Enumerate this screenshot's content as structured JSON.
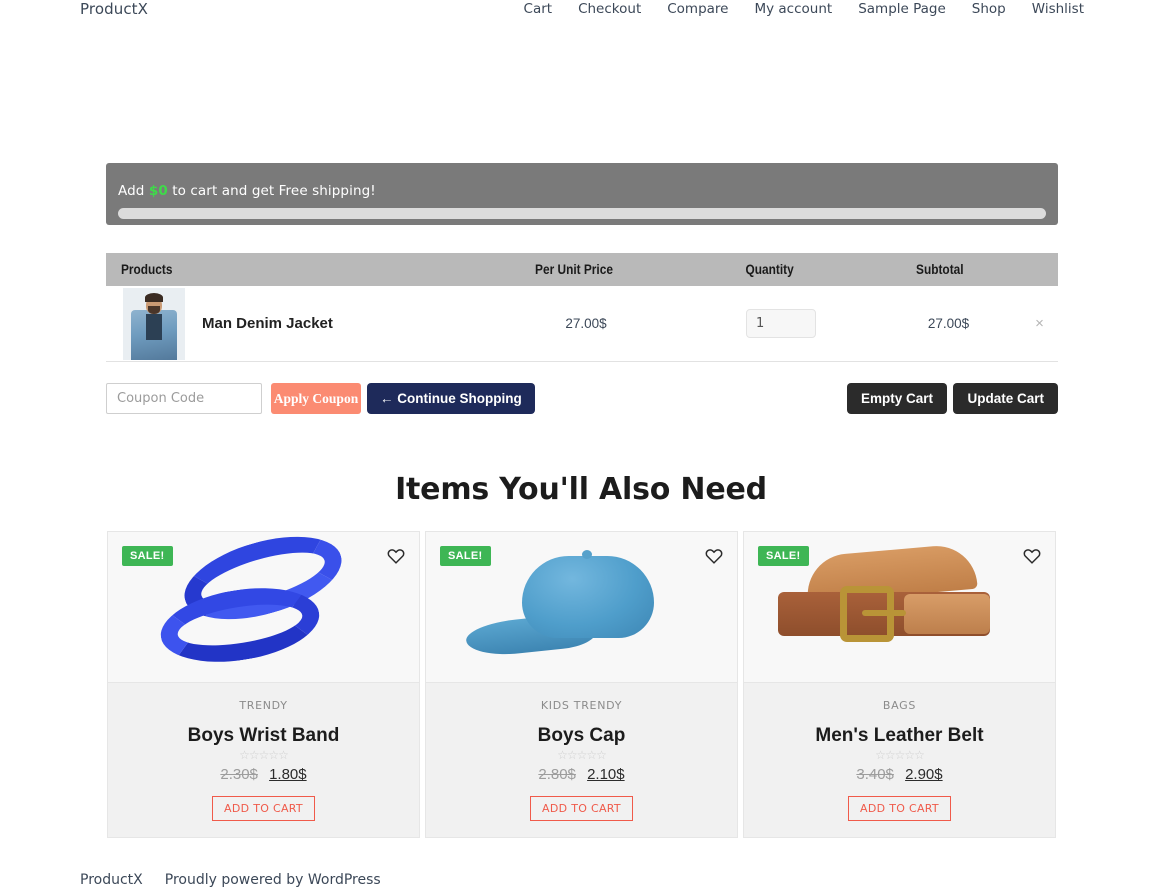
{
  "header": {
    "brand": "ProductX",
    "nav": [
      {
        "label": "Cart"
      },
      {
        "label": "Checkout"
      },
      {
        "label": "Compare"
      },
      {
        "label": "My account"
      },
      {
        "label": "Sample Page"
      },
      {
        "label": "Shop"
      },
      {
        "label": "Wishlist"
      }
    ]
  },
  "shipping_banner": {
    "text_before": "Add",
    "amount": "$0",
    "text_after": "to cart and get Free shipping!",
    "progress_percent": 0,
    "bar_color": "#dcdcdc",
    "background": "#7a7a7a",
    "amount_color": "#3fd94a"
  },
  "cart": {
    "columns": [
      "Products",
      "Per Unit Price",
      "Quantity",
      "Subtotal"
    ],
    "rows": [
      {
        "name": "Man Denim Jacket",
        "unit_price": "27.00$",
        "quantity": "1",
        "subtotal": "27.00$",
        "remove_label": "×",
        "thumbnail": "man-denim-jacket-thumbnail"
      }
    ],
    "coupon_placeholder": "Coupon Code",
    "coupon_value": "",
    "apply_coupon_label": "Apply Coupon",
    "continue_shopping_label": "← Continue Shopping",
    "empty_cart_label": "Empty Cart",
    "update_cart_label": "Update Cart"
  },
  "upsell": {
    "title": "Items You'll Also Need",
    "sale_badge": "SALE!",
    "add_to_cart_label": "ADD TO CART",
    "stars": "☆☆☆☆☆",
    "products": [
      {
        "category": "TRENDY",
        "name": "Boys Wrist Band",
        "old_price": "2.30$",
        "new_price": "1.80$",
        "image": "blue-wrist-band"
      },
      {
        "category": "KIDS TRENDY",
        "name": "Boys Cap",
        "old_price": "2.80$",
        "new_price": "2.10$",
        "image": "blue-baseball-cap"
      },
      {
        "category": "BAGS",
        "name": "Men's Leather Belt",
        "old_price": "3.40$",
        "new_price": "2.90$",
        "image": "brown-leather-belt"
      }
    ]
  },
  "footer": {
    "brand": "ProductX",
    "credit": "Proudly powered by WordPress"
  }
}
